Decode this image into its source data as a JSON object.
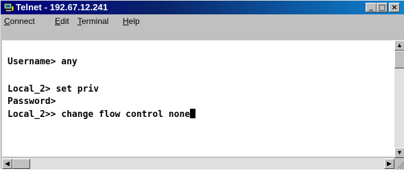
{
  "window": {
    "title": "Telnet - 192.67.12.241",
    "icon": "telnet-computer-icon",
    "controls": {
      "minimize": "_",
      "maximize": "□",
      "close": "×"
    }
  },
  "menu": {
    "items": [
      {
        "mnemonic": "C",
        "rest": "onnect"
      },
      {
        "mnemonic": "E",
        "rest": "dit"
      },
      {
        "mnemonic": "T",
        "rest": "erminal"
      },
      {
        "mnemonic": "H",
        "rest": "elp"
      }
    ]
  },
  "terminal": {
    "lines": [
      "Username> any",
      "Local_2> set priv",
      "Password>",
      "Local_2>> change flow control none"
    ]
  },
  "scrollbars": {
    "up_arrow": "▲",
    "down_arrow": "▼",
    "left_arrow": "◀",
    "right_arrow": "▶"
  }
}
